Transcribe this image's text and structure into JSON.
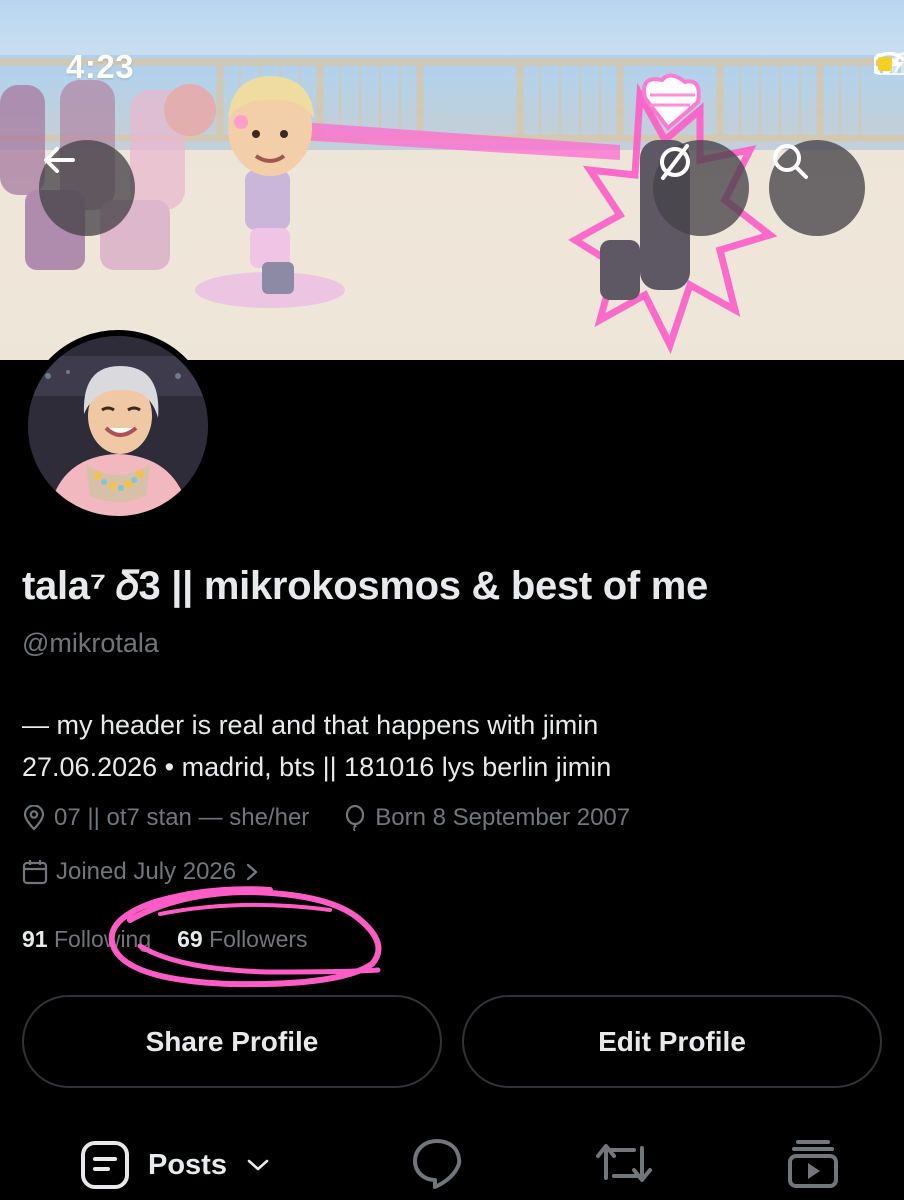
{
  "status_bar": {
    "time": "4:23"
  },
  "header": {
    "back_icon": "arrow-left-icon",
    "grok_icon": "slashed-circle-icon",
    "search_icon": "search-icon"
  },
  "profile": {
    "display_name": "tala⁷ 𝛿3 || mikrokosmos & best of me",
    "handle": "@mikrotala",
    "bio_lines": [
      "— my header is real and that happens with jimin",
      "27.06.2026 • madrid, bts || 181016 lys berlin jimin"
    ],
    "location": "07 || ot7 stan — she/her",
    "birthday": "Born 8 September 2007",
    "joined": "Joined July 2026",
    "following_count": "91",
    "following_label": "Following",
    "followers_count": "69",
    "followers_label": "Followers"
  },
  "actions": {
    "share_label": "Share Profile",
    "edit_label": "Edit Profile"
  },
  "tabs": {
    "posts_label": "Posts"
  },
  "colors": {
    "background": "#000000",
    "text_primary": "#e7e9ea",
    "text_secondary": "#71767b",
    "border": "#2f3336",
    "annotation_pink": "#ff5cc6"
  }
}
